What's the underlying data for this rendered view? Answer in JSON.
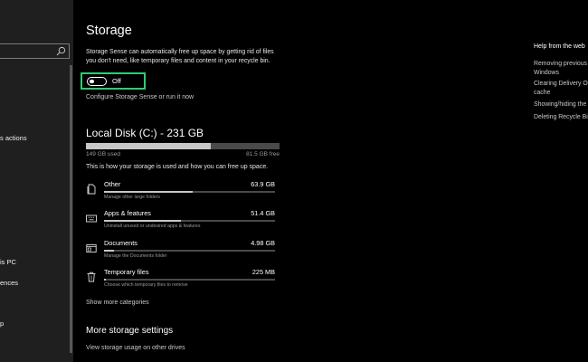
{
  "nav": {
    "items": [
      {
        "label": "s actions"
      },
      {
        "label": "is PC"
      },
      {
        "label": "ences"
      },
      {
        "label": "p"
      }
    ]
  },
  "storage": {
    "title": "Storage",
    "description": "Storage Sense can automatically free up space by getting rid of files you don't need, like temporary files and content in your recycle bin.",
    "toggle_label": "Off",
    "toggle_on": false,
    "configure_link": "Configure Storage Sense or run it now"
  },
  "disk": {
    "title": "Local Disk (C:) - 231 GB",
    "used_label": "149 GB used",
    "free_label": "81.5 GB free",
    "used_fraction": 0.645,
    "usage_note": "This is how your storage is used and how you can free up space."
  },
  "categories": [
    {
      "name": "Other",
      "size": "63.9 GB",
      "sub": "Manage other large folders",
      "fraction": 0.52,
      "icon": "document-icon"
    },
    {
      "name": "Apps & features",
      "size": "51.4 GB",
      "sub": "Uninstall unused or undesired apps & features",
      "fraction": 0.45,
      "icon": "keyboard-icon"
    },
    {
      "name": "Documents",
      "size": "4.98 GB",
      "sub": "Manage the Documents folder",
      "fraction": 0.06,
      "icon": "folder-icon"
    },
    {
      "name": "Temporary files",
      "size": "225 MB",
      "sub": "Choose which temporary files to remove",
      "fraction": 0.01,
      "icon": "trash-icon"
    }
  ],
  "show_more": "Show more categories",
  "more_settings": {
    "title": "More storage settings",
    "link": "View storage usage on other drives"
  },
  "help": {
    "title": "Help from the web",
    "links": [
      {
        "line1": "Removing previous",
        "line2": "Windows"
      },
      {
        "line1": "Clearing Delivery O",
        "line2": "cache"
      },
      {
        "line1": "Showing/hiding the",
        "line2": ""
      },
      {
        "line1": "Deleting Recycle Bi",
        "line2": ""
      }
    ]
  },
  "colors": {
    "background": "#000000",
    "nav_background": "#1f1f1f",
    "highlight": "#2ecc6e",
    "bar_fill": "#c7c7c7",
    "bar_track": "#4a4a4a"
  }
}
